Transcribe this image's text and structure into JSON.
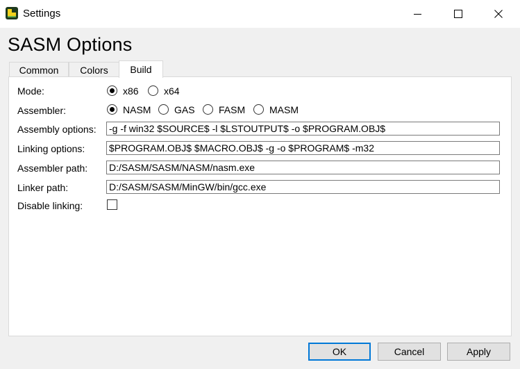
{
  "window": {
    "title": "Settings",
    "controls": [
      "minimize-icon",
      "maximize-icon",
      "close-icon"
    ]
  },
  "heading": "SASM Options",
  "tabs": [
    {
      "label": "Common",
      "active": false
    },
    {
      "label": "Colors",
      "active": false
    },
    {
      "label": "Build",
      "active": true
    }
  ],
  "build": {
    "mode": {
      "label": "Mode:",
      "options": [
        {
          "label": "x86",
          "selected": true
        },
        {
          "label": "x64",
          "selected": false
        }
      ]
    },
    "assembler": {
      "label": "Assembler:",
      "options": [
        {
          "label": "NASM",
          "selected": true
        },
        {
          "label": "GAS",
          "selected": false
        },
        {
          "label": "FASM",
          "selected": false
        },
        {
          "label": "MASM",
          "selected": false
        }
      ]
    },
    "assembly_options": {
      "label": "Assembly options:",
      "value": "-g -f win32 $SOURCE$ -l $LSTOUTPUT$ -o $PROGRAM.OBJ$"
    },
    "linking_options": {
      "label": "Linking options:",
      "value": "$PROGRAM.OBJ$ $MACRO.OBJ$ -g -o $PROGRAM$ -m32"
    },
    "assembler_path": {
      "label": "Assembler path:",
      "value": "D:/SASM/SASM/NASM/nasm.exe"
    },
    "linker_path": {
      "label": "Linker path:",
      "value": "D:/SASM/SASM/MinGW/bin/gcc.exe"
    },
    "disable_linking": {
      "label": "Disable linking:",
      "checked": false
    }
  },
  "buttons": {
    "ok": "OK",
    "cancel": "Cancel",
    "apply": "Apply"
  },
  "colors": {
    "accent": "#0078d7",
    "icon_yellow": "#f2d21b",
    "icon_dark": "#1e3a1e"
  }
}
